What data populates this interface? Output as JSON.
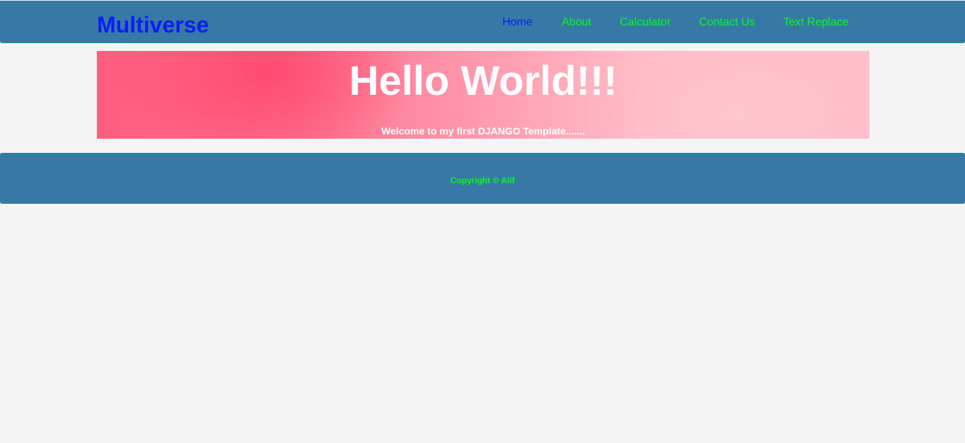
{
  "header": {
    "brand": "Multiverse",
    "nav": [
      {
        "label": "Home",
        "active": true
      },
      {
        "label": "About",
        "active": false
      },
      {
        "label": "Calculator",
        "active": false
      },
      {
        "label": "Contact Us",
        "active": false
      },
      {
        "label": "Text Replace",
        "active": false
      }
    ]
  },
  "hero": {
    "title": "Hello World!!!",
    "subtitle": "Welcome to my first DJANGO Template......."
  },
  "footer": {
    "copyright": "Copyright © Alif"
  },
  "colors": {
    "bar_background": "#3779a4",
    "brand": "#0b1ef5",
    "nav_link": "#00ff1a",
    "nav_active": "#0b1ef5",
    "page_background": "#f4f4f4"
  }
}
